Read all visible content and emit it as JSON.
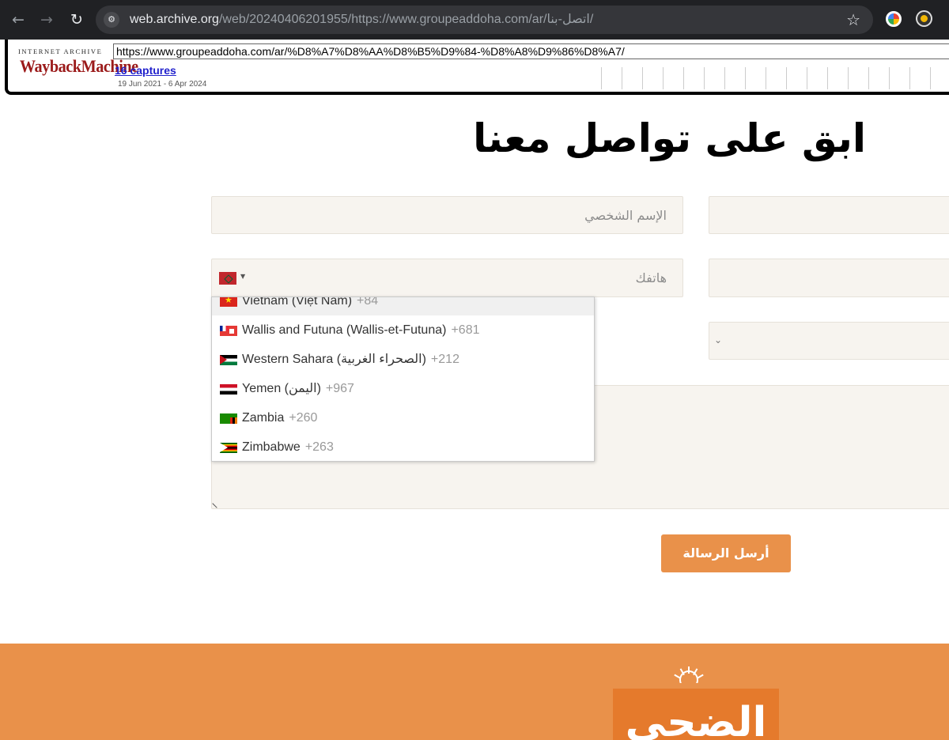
{
  "browser": {
    "url_host": "web.archive.org",
    "url_rest": "/web/20240406201955/https://www.groupeaddoha.com/ar/اتصل-بنا/",
    "icons": [
      "back-arrow-icon",
      "forward-arrow-icon",
      "reload-icon",
      "site-info-icon",
      "bookmark-star-icon",
      "color-wheel-extension-icon",
      "extension-icon"
    ]
  },
  "wayback": {
    "logo_top": "INTERNET ARCHIVE",
    "logo_main": "WaybackMachine",
    "url_value": "https://www.groupeaddoha.com/ar/%D8%A7%D8%AA%D8%B5%D9%84-%D8%A8%D9%86%D8%A7/",
    "captures": "16 captures",
    "dates": "19 Jun 2021 - 6 Apr 2024"
  },
  "page": {
    "heading": "ابق على تواصل معنا",
    "form": {
      "name_placeholder": "الإسم الشخصي",
      "phone_placeholder": "هاتفك",
      "submit_label": "أرسل الرسالة"
    },
    "country_dropdown": {
      "selected_flag": "morocco-flag-icon",
      "items": [
        {
          "name": "Vietnam (Việt Nam)",
          "code": "+84",
          "flag": "vietnam-flag-icon"
        },
        {
          "name": "Wallis and Futuna (Wallis-et-Futuna)",
          "code": "+681",
          "flag": "wallis-futuna-flag-icon"
        },
        {
          "name": "Western Sahara (الصحراء الغربية)",
          "code": "+212",
          "flag": "western-sahara-flag-icon"
        },
        {
          "name": "Yemen (اليمن)",
          "code": "+967",
          "flag": "yemen-flag-icon"
        },
        {
          "name": "Zambia",
          "code": "+260",
          "flag": "zambia-flag-icon"
        },
        {
          "name": "Zimbabwe",
          "code": "+263",
          "flag": "zimbabwe-flag-icon"
        }
      ]
    },
    "footer": {
      "logo_text": "الضحى"
    }
  },
  "colors": {
    "accent_orange": "#e9914a",
    "logo_box": "#e57a2c",
    "field_bg": "#f7f4ef",
    "wayback_red": "#9b1a1a"
  }
}
